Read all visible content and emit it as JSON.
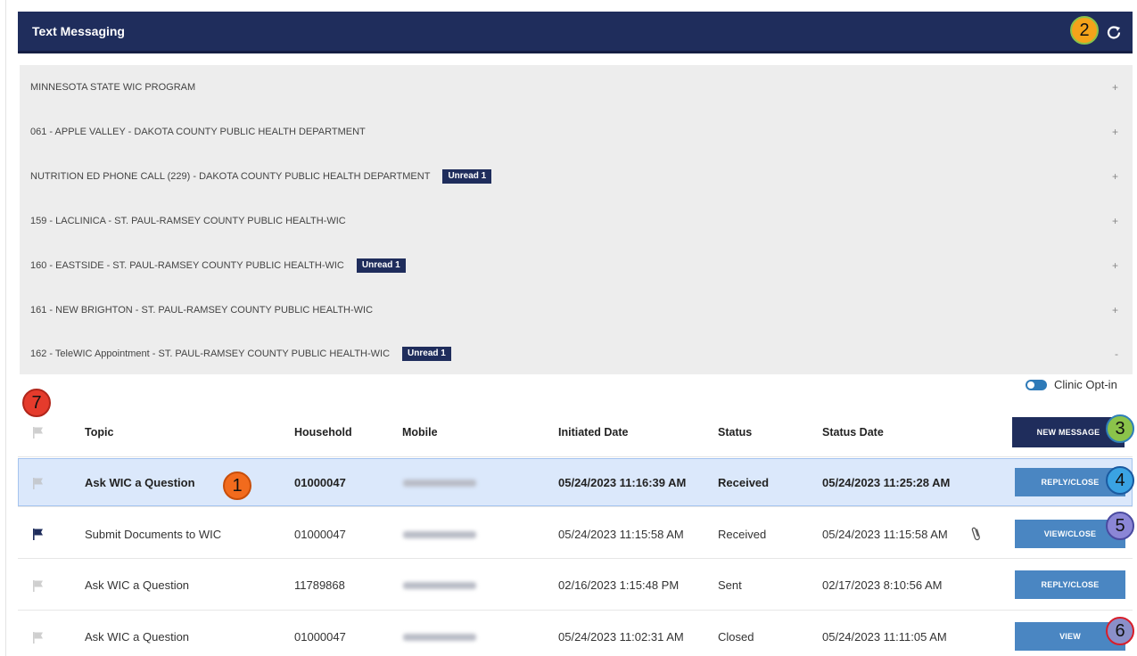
{
  "header": {
    "title": "Text Messaging",
    "refresh_icon": "refresh-icon"
  },
  "clinics": [
    {
      "name": "MINNESOTA STATE WIC PROGRAM",
      "unread": "",
      "expand": "+"
    },
    {
      "name": "061 - APPLE VALLEY - DAKOTA COUNTY PUBLIC HEALTH DEPARTMENT",
      "unread": "",
      "expand": "+"
    },
    {
      "name": "NUTRITION ED PHONE CALL (229) - DAKOTA COUNTY PUBLIC HEALTH DEPARTMENT",
      "unread": "Unread 1",
      "expand": "+"
    },
    {
      "name": "159 - LACLINICA - ST. PAUL-RAMSEY COUNTY PUBLIC HEALTH-WIC",
      "unread": "",
      "expand": "+"
    },
    {
      "name": "160 - EASTSIDE - ST. PAUL-RAMSEY COUNTY PUBLIC HEALTH-WIC",
      "unread": "Unread 1",
      "expand": "+"
    },
    {
      "name": "161 - NEW BRIGHTON - ST. PAUL-RAMSEY COUNTY PUBLIC HEALTH-WIC",
      "unread": "",
      "expand": "+"
    },
    {
      "name": "162 - TeleWIC Appointment - ST. PAUL-RAMSEY COUNTY PUBLIC HEALTH-WIC",
      "unread": "Unread 1",
      "expand": "-"
    }
  ],
  "opt_in": {
    "label": "Clinic Opt-in",
    "enabled": true
  },
  "table": {
    "columns": [
      "Topic",
      "Household",
      "Mobile",
      "Initiated Date",
      "Status",
      "Status Date"
    ],
    "new_message_label": "NEW MESSAGE",
    "rows": [
      {
        "flagged": false,
        "topic": "Ask WIC a Question",
        "household": "01000047",
        "initiated": "05/24/2023 11:16:39 AM",
        "status": "Received",
        "status_date": "05/24/2023 11:25:28 AM",
        "action": "REPLY/CLOSE",
        "attachment": false,
        "selected": true
      },
      {
        "flagged": true,
        "topic": "Submit Documents to WIC",
        "household": "01000047",
        "initiated": "05/24/2023 11:15:58 AM",
        "status": "Received",
        "status_date": "05/24/2023 11:15:58 AM",
        "action": "VIEW/CLOSE",
        "attachment": true,
        "selected": false
      },
      {
        "flagged": false,
        "topic": "Ask WIC a Question",
        "household": "11789868",
        "initiated": "02/16/2023 1:15:48 PM",
        "status": "Sent",
        "status_date": "02/17/2023 8:10:56 AM",
        "action": "REPLY/CLOSE",
        "attachment": false,
        "selected": false
      },
      {
        "flagged": false,
        "topic": "Ask WIC a Question",
        "household": "01000047",
        "initiated": "05/24/2023 11:02:31 AM",
        "status": "Closed",
        "status_date": "05/24/2023 11:11:05 AM",
        "action": "VIEW",
        "attachment": false,
        "selected": false
      }
    ]
  },
  "callouts": [
    {
      "label": "1",
      "color": "#f26b1d"
    },
    {
      "label": "2",
      "color": "#f5a31a"
    },
    {
      "label": "3",
      "color": "#8bc34a"
    },
    {
      "label": "4",
      "color": "#3aa3e3"
    },
    {
      "label": "5",
      "color": "#8b86d6"
    },
    {
      "label": "6",
      "color": "#8a8fc9"
    },
    {
      "label": "7",
      "color": "#e53b2c"
    }
  ],
  "colors": {
    "navy": "#1f2d5c",
    "button_light": "#4a86c2",
    "selected_row": "#dbe8fb"
  }
}
